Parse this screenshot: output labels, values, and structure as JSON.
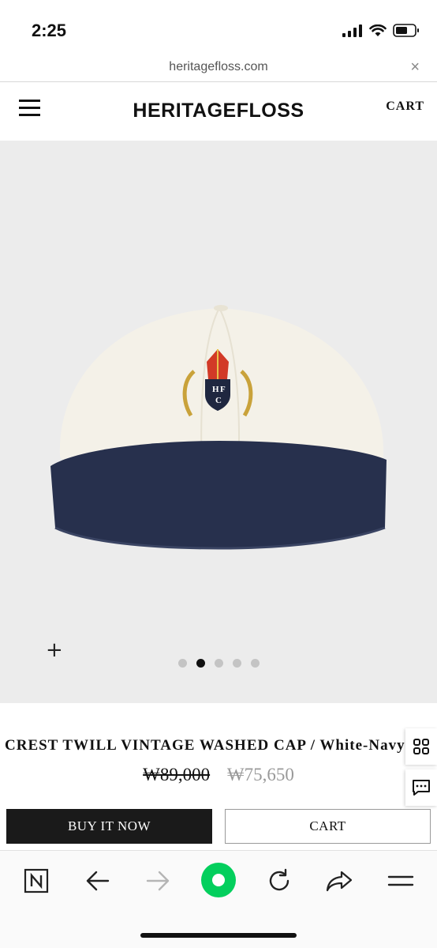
{
  "status_bar": {
    "time": "2:25"
  },
  "url_bar": {
    "url": "heritagefloss.com",
    "close_glyph": "×"
  },
  "header": {
    "menu_icon": "hamburger-menu-icon",
    "logo": "HERITAGEFLOSS",
    "cart_label": "CART"
  },
  "gallery": {
    "zoom_glyph": "+",
    "image_count": 5,
    "active_index": 1,
    "image_alt_colors": {
      "crown": "#f4f1e8",
      "brim": "#27304d",
      "background": "#ececec"
    }
  },
  "product": {
    "title": "CREST TWILL VINTAGE WASHED CAP / White-Navy",
    "price_original": "₩89,000",
    "price_sale": "₩75,650",
    "buy_now_label": "BUY IT NOW",
    "cart_label": "CART"
  },
  "side_actions": {
    "grid_icon": "grid-icon",
    "chat_icon": "chat-icon"
  },
  "toolbar": {
    "icons": [
      "naver-n-icon",
      "back-arrow-icon",
      "forward-arrow-icon",
      "green-dot-icon",
      "reload-icon",
      "share-icon",
      "menu-lines-icon"
    ],
    "accent": "#03cf5d"
  }
}
